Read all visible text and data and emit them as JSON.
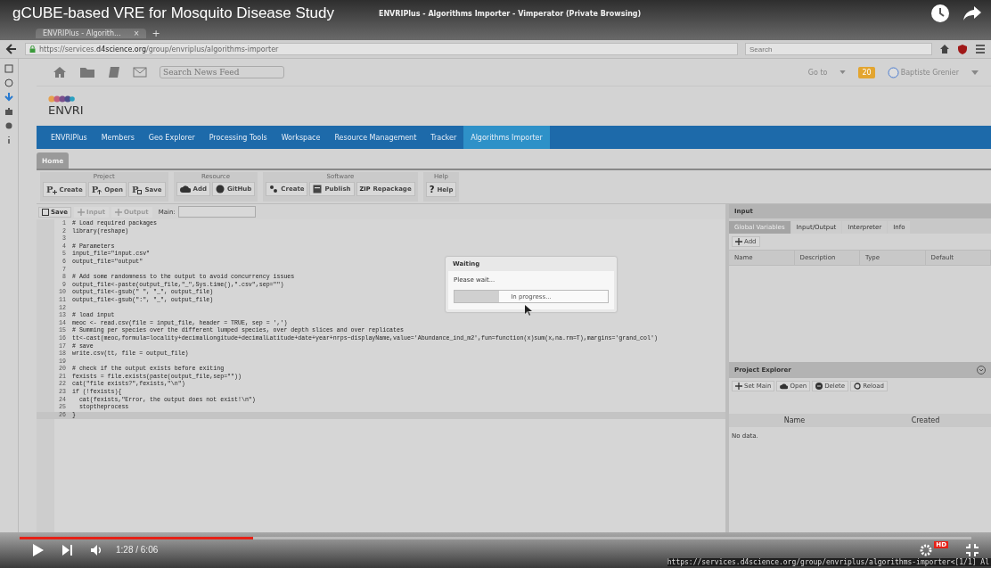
{
  "video": {
    "title": "gCUBE-based VRE for Mosquito Disease Study",
    "time": "1:28 / 6:06",
    "level": 0.245,
    "hd": "HD"
  },
  "browser": {
    "window_title": "ENVRIPlus - Algorithms Importer - Vimperator (Private Browsing)",
    "tab": "ENVRIPlus - Algorith...",
    "tab_close": "×",
    "new_tab": "+",
    "url": "https://services.**d4science.org**/group/envriplus/algorithms-importer",
    "search_placeholder": "Search",
    "status_url": "https://services.d4science.org/group/envriplus/algorithms-importer",
    "status_mode": "<[1/1] Al"
  },
  "portal": {
    "search_placeholder": "Search News Feed",
    "goto": "Go to",
    "notifications": "20",
    "user": "Baptiste Grenier",
    "logo": "ENVRI",
    "nav": [
      {
        "label": "ENVRIPlus",
        "selected": false
      },
      {
        "label": "Members",
        "selected": false
      },
      {
        "label": "Geo Explorer",
        "selected": false
      },
      {
        "label": "Processing Tools",
        "selected": false
      },
      {
        "label": "Workspace",
        "selected": false
      },
      {
        "label": "Resource Management",
        "selected": false
      },
      {
        "label": "Tracker",
        "selected": false
      },
      {
        "label": "Algorithms Importer",
        "selected": true
      }
    ],
    "home_tab": "Home"
  },
  "toolbar": [
    {
      "title": "Project",
      "buttons": [
        {
          "label": "Create",
          "kind": "pcreate",
          "icon_text": "P"
        },
        {
          "label": "Open",
          "kind": "popen",
          "icon_text": "P"
        },
        {
          "label": "Save",
          "kind": "psave",
          "icon_text": "P"
        }
      ]
    },
    {
      "title": "Resource",
      "buttons": [
        {
          "label": "Add",
          "kind": "cloud"
        },
        {
          "label": "GitHub",
          "kind": "github"
        }
      ]
    },
    {
      "title": "Software",
      "buttons": [
        {
          "label": "Create",
          "kind": "people"
        },
        {
          "label": "Publish",
          "kind": "publish"
        },
        {
          "label": "Repackage",
          "kind": "zip",
          "icon_text": "ZIP"
        }
      ]
    },
    {
      "title": "Help",
      "buttons": [
        {
          "label": "Help",
          "kind": "help",
          "icon_text": "?"
        }
      ]
    }
  ],
  "editor": {
    "buttons": [
      {
        "label": "Save",
        "kind": "save",
        "disabled": false
      },
      {
        "label": "Input",
        "kind": "plus",
        "disabled": true
      },
      {
        "label": "Output",
        "kind": "plus",
        "disabled": true
      }
    ],
    "main_label": "Main:",
    "lines": [
      {
        "n": "1",
        "code": "# Load required packages",
        "current": false
      },
      {
        "n": "2",
        "code": "library(reshape)",
        "current": false
      },
      {
        "n": "3",
        "current": false
      },
      {
        "n": "4",
        "code": "# Parameters",
        "current": false
      },
      {
        "n": "5",
        "code": "input_file=\"input.csv\"",
        "current": false
      },
      {
        "n": "6",
        "code": "output_file=\"output\"",
        "current": false
      },
      {
        "n": "7",
        "current": false
      },
      {
        "n": "8",
        "code": "# Add some randomness to the output to avoid concurrency issues",
        "current": false
      },
      {
        "n": "9",
        "code": "output_file<-paste(output_file,\"_\",Sys.time(),\".csv\",sep=\"\")",
        "current": false
      },
      {
        "n": "10",
        "code": "output_file<-gsub(\" \", \"_\", output_file)",
        "current": false
      },
      {
        "n": "11",
        "code": "output_file<-gsub(\":\", \"_\", output_file)",
        "current": false
      },
      {
        "n": "12",
        "current": false
      },
      {
        "n": "13",
        "code": "# load input",
        "current": false
      },
      {
        "n": "14",
        "code": "meoc <- read.csv(file = input_file, header = TRUE, sep = ',')",
        "current": false
      },
      {
        "n": "15",
        "code": "# Summing per species over the different lumped species, over depth slices and over replicates",
        "current": false
      },
      {
        "n": "16",
        "code": "tt<-cast(meoc,formula=locality+decimalLongitude+decimalLatitude+date+year+nrps~displayName,value='Abundance_ind_m2',fun=function(x)sum(x,na.rm=T),margins='grand_col')",
        "current": false
      },
      {
        "n": "17",
        "code": "# save",
        "current": false
      },
      {
        "n": "18",
        "code": "write.csv(tt, file = output_file)",
        "current": false
      },
      {
        "n": "19",
        "current": false
      },
      {
        "n": "20",
        "code": "# check if the output exists before exiting",
        "current": false
      },
      {
        "n": "21",
        "code": "fexists = file.exists(paste(output_file,sep=\"\"))",
        "current": false
      },
      {
        "n": "22",
        "code": "cat(\"file exists?\",fexists,\"\\n\")",
        "current": false
      },
      {
        "n": "23",
        "code": "if (!fexists){",
        "current": false
      },
      {
        "n": "24",
        "code": "  cat(fexists,\"Error, the output does not exist!\\n\")",
        "current": false
      },
      {
        "n": "25",
        "code": "  stoptheprocess",
        "current": false
      },
      {
        "n": "26",
        "code": "}",
        "current": true
      }
    ]
  },
  "dialog": {
    "title": "Waiting",
    "message": "Please wait...",
    "progress_text": "In progress...",
    "level": 0.29
  },
  "input_panel": {
    "title": "Input",
    "tabs": [
      {
        "label": "Global Variables",
        "selected": true
      },
      {
        "label": "Input/Output",
        "selected": false
      },
      {
        "label": "Interpreter",
        "selected": false
      },
      {
        "label": "Info",
        "selected": false
      }
    ],
    "add": "Add",
    "columns": [
      "Name",
      "Description",
      "Type",
      "Default"
    ]
  },
  "project_explorer": {
    "title": "Project Explorer",
    "buttons": [
      {
        "label": "Set Main",
        "kind": "plus"
      },
      {
        "label": "Open",
        "kind": "cloud"
      },
      {
        "label": "Delete",
        "kind": "minus"
      },
      {
        "label": "Reload",
        "kind": "reload"
      }
    ],
    "columns": [
      "Name",
      "Created"
    ],
    "empty": "No data."
  }
}
